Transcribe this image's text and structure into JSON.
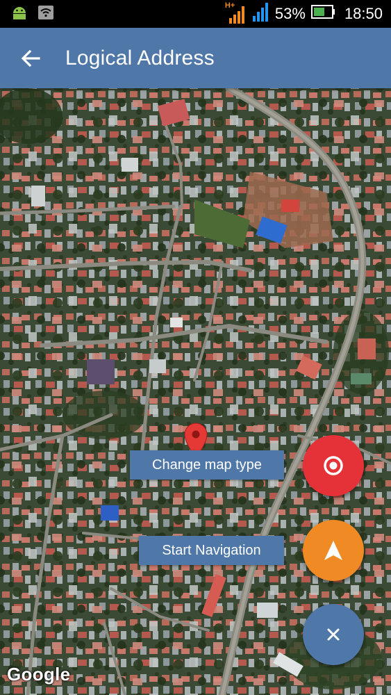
{
  "status_bar": {
    "network_type": "H+",
    "battery_percent": "53%",
    "time": "18:50",
    "icons": [
      "android-icon",
      "wifi-icon",
      "signal-icon",
      "signal-icon",
      "battery-icon"
    ]
  },
  "app_bar": {
    "back_icon": "arrow-left-icon",
    "title": "Logical Address"
  },
  "map": {
    "type": "satellite",
    "marker_icon": "map-pin-icon",
    "marker_color": "#e53935",
    "attribution": "Google"
  },
  "fabs": [
    {
      "label": "Change map type",
      "icon": "target-icon",
      "color": "#e53238"
    },
    {
      "label": "Start Navigation",
      "icon": "navigation-arrow-icon",
      "color": "#f08a24"
    },
    {
      "icon": "close-icon",
      "color": "#4f77a8"
    }
  ],
  "colors": {
    "app_bar": "#4f77a8",
    "status_bar": "#000000"
  }
}
